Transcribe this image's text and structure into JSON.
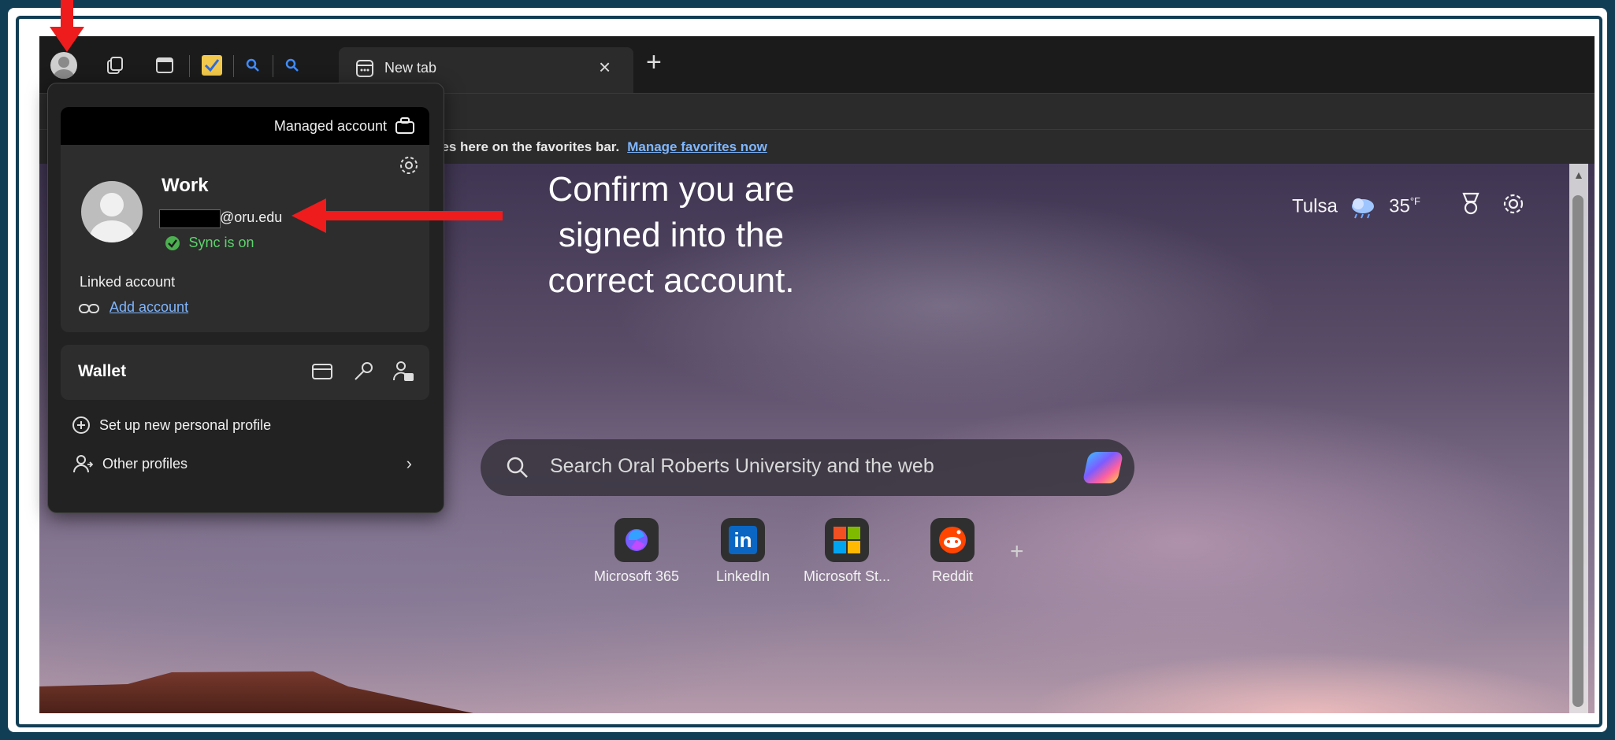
{
  "browser": {
    "tab_title": "New tab",
    "favorites_bar": {
      "text": "ites here on the favorites bar.",
      "link": "Manage favorites now"
    }
  },
  "profile_panel": {
    "managed_label": "Managed account",
    "profile_name": "Work",
    "email_suffix": "@oru.edu",
    "sync_status": "Sync is on",
    "linked_account_label": "Linked account",
    "add_account_link": "Add account",
    "wallet_label": "Wallet",
    "new_profile_label": "Set up new personal profile",
    "other_profiles_label": "Other profiles"
  },
  "new_tab_page": {
    "weather_city": "Tulsa",
    "weather_temp": "35",
    "weather_unit": "°F",
    "search_placeholder": "Search Oral Roberts University and the web",
    "quick_links": [
      {
        "label": "Microsoft 365",
        "icon": "microsoft-365-icon"
      },
      {
        "label": "LinkedIn",
        "icon": "linkedin-icon"
      },
      {
        "label": "Microsoft St...",
        "icon": "microsoft-store-icon"
      },
      {
        "label": "Reddit",
        "icon": "reddit-icon"
      }
    ],
    "add_link_glyph": "+"
  },
  "annotation": {
    "lines": [
      "Confirm you are",
      "signed into the",
      "correct account."
    ],
    "arrow_color": "#ee1c1c"
  },
  "colors": {
    "accent_link": "#7fb6ff",
    "sync_green": "#4caf50",
    "slide_border": "#123e55"
  }
}
